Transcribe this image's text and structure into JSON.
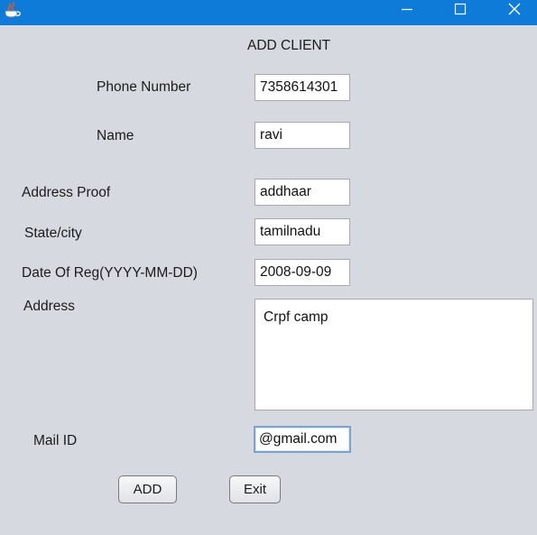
{
  "window": {
    "app_icon": "java-cup-icon",
    "minimize_icon": "minimize-icon",
    "maximize_icon": "maximize-icon",
    "close_icon": "close-icon",
    "titlebar_color": "#0f7bd8",
    "background_color": "#d6d9df"
  },
  "form": {
    "title": "ADD CLIENT",
    "phone": {
      "label": "Phone Number",
      "value": "7358614301"
    },
    "name": {
      "label": "Name",
      "value": "ravi"
    },
    "address_proof": {
      "label": "Address Proof",
      "value": "addhaar"
    },
    "state_city": {
      "label": "State/city",
      "value": "tamilnadu"
    },
    "date_of_reg": {
      "label": "Date Of Reg(YYYY-MM-DD)",
      "value": "2008-09-09"
    },
    "address": {
      "label": "Address",
      "value": "Crpf camp"
    },
    "mail_id": {
      "label": "Mail ID",
      "value": "@gmail.com"
    }
  },
  "buttons": {
    "add_label": "ADD",
    "exit_label": "Exit"
  }
}
